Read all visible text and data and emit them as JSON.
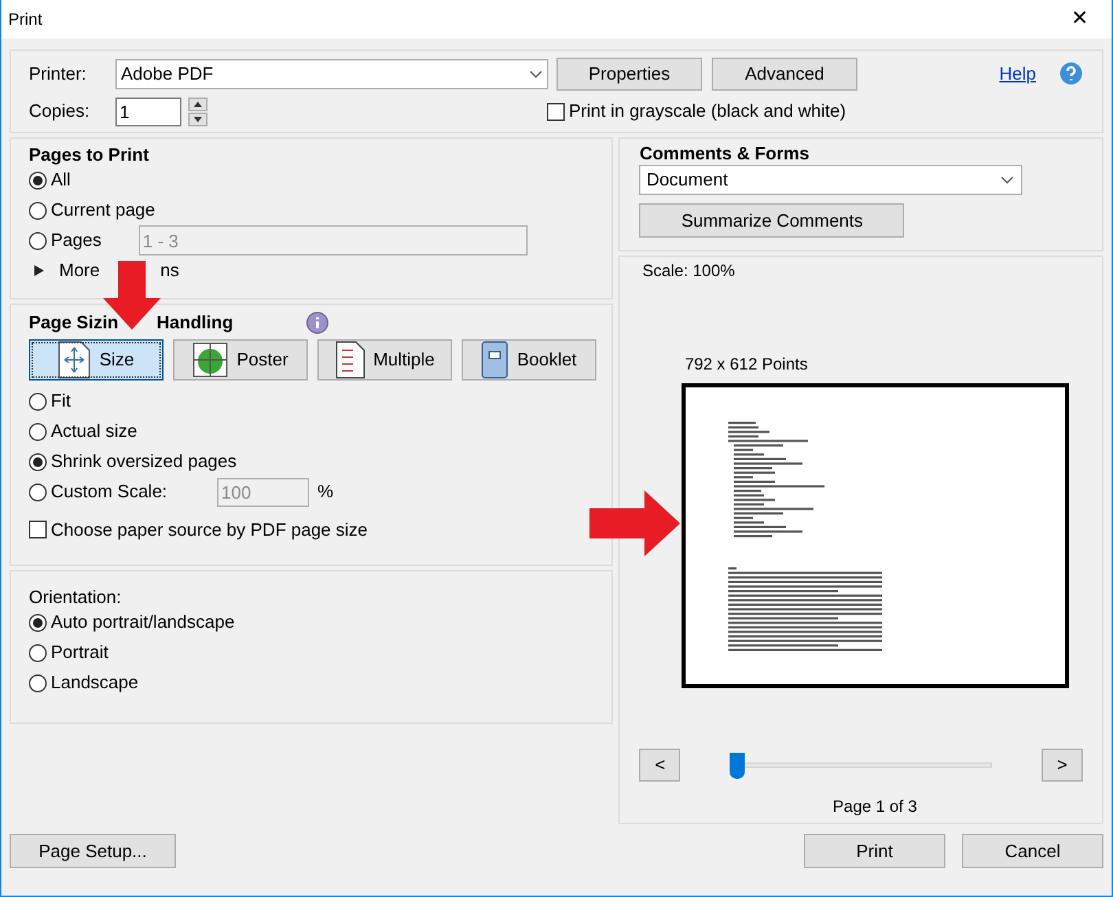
{
  "window": {
    "title": "Print",
    "close": "✕"
  },
  "printer": {
    "label": "Printer:",
    "value": "Adobe PDF"
  },
  "top_buttons": [
    "Properties",
    "Advanced"
  ],
  "help": "Help",
  "copies": {
    "label": "Copies:",
    "value": "1"
  },
  "grayscale": {
    "label": "Print in grayscale (black and white)",
    "checked": false
  },
  "pages_to_print": {
    "title": "Pages to Print",
    "options": [
      {
        "label": "All",
        "selected": true
      },
      {
        "label": "Current page",
        "selected": false
      },
      {
        "label": "Pages",
        "selected": false
      }
    ],
    "pages_value": "1 - 3",
    "more_options": {
      "label_parts": [
        "More",
        "ns"
      ],
      "expanded": false
    }
  },
  "page_sizing": {
    "title_parts": [
      "Page Sizin",
      "Handling"
    ],
    "modes": [
      {
        "label": "Size",
        "selected": true,
        "kind": "size"
      },
      {
        "label": "Poster",
        "selected": false,
        "kind": "poster"
      },
      {
        "label": "Multiple",
        "selected": false,
        "kind": "multiple"
      },
      {
        "label": "Booklet",
        "selected": false,
        "kind": "booklet"
      }
    ],
    "options": [
      {
        "label": "Fit",
        "selected": false
      },
      {
        "label": "Actual size",
        "selected": false
      },
      {
        "label": "Shrink oversized pages",
        "selected": true
      }
    ],
    "custom_scale": {
      "label": "Custom Scale:",
      "selected": false,
      "value": "100",
      "unit": "%"
    },
    "paper_source": {
      "label": "Choose paper source by PDF page size",
      "checked": false
    }
  },
  "orientation": {
    "title": "Orientation:",
    "options": [
      {
        "label": "Auto portrait/landscape",
        "selected": true
      },
      {
        "label": "Portrait",
        "selected": false
      },
      {
        "label": "Landscape",
        "selected": false
      }
    ]
  },
  "comments_forms": {
    "title": "Comments & Forms",
    "value": "Document",
    "button": "Summarize Comments"
  },
  "preview": {
    "scale": "Scale: 100%",
    "size": "792 x 612 Points",
    "prev": "<",
    "next": ">",
    "level": 0,
    "page": "Page 1 of 3"
  },
  "footer_buttons": [
    "Page Setup...",
    "Print",
    "Cancel"
  ]
}
